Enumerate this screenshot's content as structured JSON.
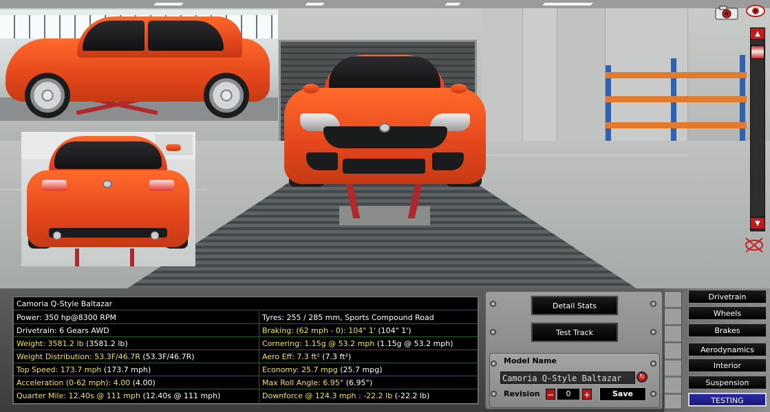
{
  "viewport": {
    "controls": {
      "camera_icon": "camera-icon",
      "eye_icon": "eye-icon",
      "scroll_up_glyph": "▲",
      "scroll_down_glyph": "▼",
      "hide_icon": "hide-view-icon"
    }
  },
  "stats": {
    "car_name": "Camoria Q-Style Baltazar",
    "left": [
      {
        "label": "Power: 350 hp@8300 RPM",
        "paren": "",
        "style": "white"
      },
      {
        "label": "Drivetrain: 6 Gears AWD",
        "paren": "",
        "style": "white"
      },
      {
        "label": "Weight: 3581.2 lb",
        "paren": " (3581.2 lb)",
        "style": "yellow"
      },
      {
        "label": "Weight Distribution: 53.3F/46.7R",
        "paren": " (53.3F/46.7R)",
        "style": "yellow"
      },
      {
        "label": "Top Speed: 173.7 mph",
        "paren": " (173.7 mph)",
        "style": "yellow"
      },
      {
        "label": "Acceleration (0-62 mph): 4.00",
        "paren": " (4.00)",
        "style": "yellow"
      },
      {
        "label": "Quarter Mile: 12.40s @ 111 mph",
        "paren": " (12.40s @ 111 mph)",
        "style": "yellow"
      }
    ],
    "right": [
      {
        "label": "Tyres: 255 / 285 mm, Sports Compound Road",
        "paren": "",
        "style": "white"
      },
      {
        "label": "Braking: (62 mph - 0): 104\" 1'",
        "paren": " (104\" 1')",
        "style": "yellow"
      },
      {
        "label": "Cornering: 1.15g @ 53.2 mph",
        "paren": " (1.15g @ 53.2 mph)",
        "style": "yellow"
      },
      {
        "label": "Aero Eff: 7.3 ft²",
        "paren": " (7.3 ft²)",
        "style": "yellow"
      },
      {
        "label": "Economy: 25.7 mpg",
        "paren": " (25.7 mpg)",
        "style": "yellow"
      },
      {
        "label": "Max Roll Angle: 6.95°",
        "paren": " (6.95°)",
        "style": "yellow"
      },
      {
        "label": "Downforce @ 124.3 mph : -22.2 lb",
        "paren": " (-22.2 lb)",
        "style": "yellow"
      }
    ]
  },
  "controls": {
    "detail_stats": "Detail Stats",
    "test_track": "Test Track",
    "model_name_label": "Model Name",
    "model_name_value": "Camoria Q-Style Baltazar",
    "revision_label": "Revision",
    "revision_minus": "−",
    "revision_value": "0",
    "revision_plus": "+",
    "save": "Save"
  },
  "tabs": [
    {
      "label": "Drivetrain",
      "active": false
    },
    {
      "label": "Wheels",
      "active": false
    },
    {
      "label": "Brakes",
      "active": false
    },
    {
      "label": "Aerodynamics",
      "active": false
    },
    {
      "label": "Interior",
      "active": false
    },
    {
      "label": "Suspension",
      "active": false
    },
    {
      "label": "TESTING",
      "active": true
    }
  ],
  "colors": {
    "car_body": "#e8501e",
    "stat_yellow": "#f2e43a",
    "active_tab": "#2a2aa8",
    "accent_red": "#c81e1e"
  }
}
